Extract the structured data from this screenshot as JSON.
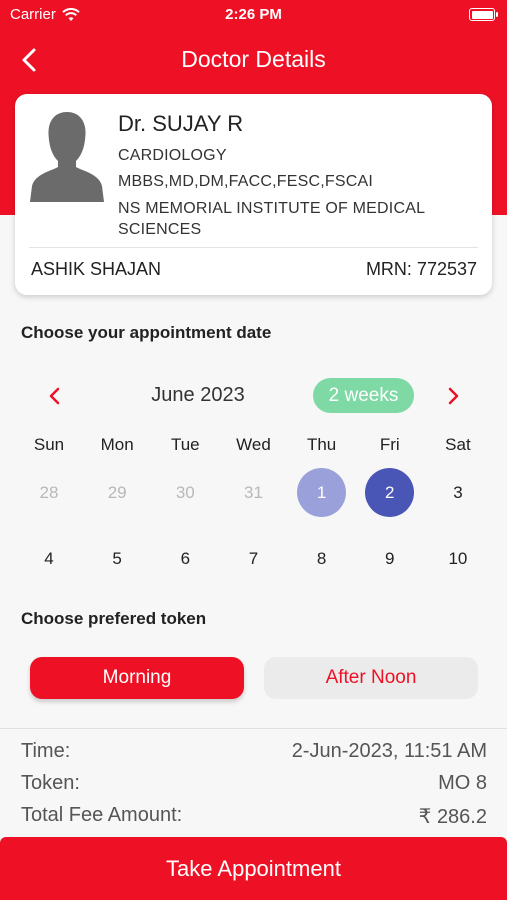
{
  "status_bar": {
    "carrier": "Carrier",
    "time": "2:26 PM"
  },
  "nav": {
    "title": "Doctor Details"
  },
  "doctor": {
    "name": "Dr. SUJAY R",
    "specialty": "CARDIOLOGY",
    "qualifications": "MBBS,MD,DM,FACC,FESC,FSCAI",
    "hospital": "NS MEMORIAL INSTITUTE OF MEDICAL SCIENCES"
  },
  "patient": {
    "name": "ASHIK SHAJAN",
    "mrn": "MRN: 772537"
  },
  "date_section": {
    "title": "Choose your appointment date"
  },
  "calendar": {
    "month": "June 2023",
    "range_label": "2 weeks",
    "weekdays": [
      "Sun",
      "Mon",
      "Tue",
      "Wed",
      "Thu",
      "Fri",
      "Sat"
    ],
    "week1": [
      "28",
      "29",
      "30",
      "31",
      "1",
      "2",
      "3"
    ],
    "week2": [
      "4",
      "5",
      "6",
      "7",
      "8",
      "9",
      "10"
    ]
  },
  "token_section": {
    "title": "Choose prefered token",
    "morning": "Morning",
    "afternoon": "After Noon"
  },
  "summary": {
    "time_label": "Time:",
    "time_value": "2-Jun-2023, 11:51 AM",
    "token_label": "Token:",
    "token_value": "MO 8",
    "fee_label": "Total Fee Amount:",
    "fee_value": "₹ 286.2"
  },
  "action": {
    "label": "Take Appointment"
  },
  "colors": {
    "brand": "#ee1126",
    "selected_day": "#4a56b5",
    "today": "#9aa1da",
    "weeks_pill": "#7fd9a5"
  }
}
